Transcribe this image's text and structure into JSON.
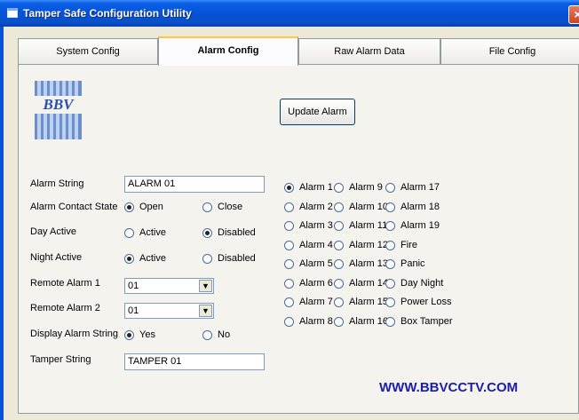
{
  "window": {
    "title": "Tamper Safe Configuration Utility",
    "close_glyph": "×"
  },
  "tabs": [
    {
      "label": "System Config",
      "active": false
    },
    {
      "label": "Alarm Config",
      "active": true
    },
    {
      "label": "Raw Alarm Data",
      "active": false
    },
    {
      "label": "File Config",
      "active": false
    }
  ],
  "logo": {
    "text": "BBV"
  },
  "update_button": "Update Alarm",
  "form": {
    "alarm_string": {
      "label": "Alarm String",
      "value": "ALARM  01"
    },
    "contact_state": {
      "label": "Alarm Contact State",
      "opt1": "Open",
      "opt2": "Close",
      "selected": "Open"
    },
    "day_active": {
      "label": "Day Active",
      "opt1": "Active",
      "opt2": "Disabled",
      "selected": "Disabled"
    },
    "night_active": {
      "label": "Night Active",
      "opt1": "Active",
      "opt2": "Disabled",
      "selected": "Active"
    },
    "remote1": {
      "label": "Remote Alarm 1",
      "value": "01"
    },
    "remote2": {
      "label": "Remote Alarm 2",
      "value": "01"
    },
    "display_string": {
      "label": "Display Alarm String",
      "opt1": "Yes",
      "opt2": "No",
      "selected": "Yes"
    },
    "tamper_string": {
      "label": "Tamper String",
      "value": "TAMPER 01"
    }
  },
  "alarm_list": {
    "col1": [
      "Alarm 1",
      "Alarm 2",
      "Alarm 3",
      "Alarm 4",
      "Alarm 5",
      "Alarm 6",
      "Alarm 7",
      "Alarm 8"
    ],
    "col2": [
      "Alarm 9",
      "Alarm 10",
      "Alarm 11",
      "Alarm 12",
      "Alarm 13",
      "Alarm 14",
      "Alarm 15",
      "Alarm 16"
    ],
    "col3": [
      "Alarm 17",
      "Alarm 18",
      "Alarm 19",
      "Fire",
      "Panic",
      "Day Night",
      "Power Loss",
      "Box Tamper"
    ],
    "selected": "Alarm 1"
  },
  "website": "WWW.BBVCCTV.COM"
}
